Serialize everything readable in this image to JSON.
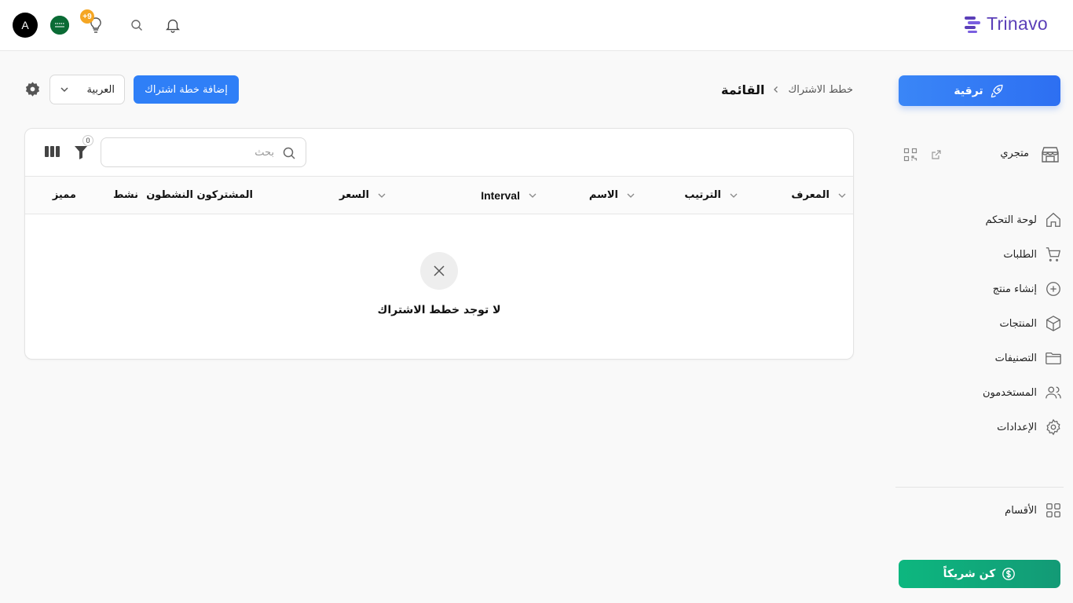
{
  "header": {
    "brand": "Trinavo",
    "avatar_letter": "A",
    "notification_badge": "+9"
  },
  "sidebar": {
    "upgrade_label": "ترقية",
    "store_label": "متجري",
    "items": [
      {
        "label": "لوحة التحكم",
        "icon": "home-icon"
      },
      {
        "label": "الطلبات",
        "icon": "cart-icon"
      },
      {
        "label": "إنشاء منتج",
        "icon": "plus-circle-icon"
      },
      {
        "label": "المنتجات",
        "icon": "box-icon"
      },
      {
        "label": "التصنيفات",
        "icon": "folder-icon"
      },
      {
        "label": "المستخدمون",
        "icon": "users-icon"
      },
      {
        "label": "الإعدادات",
        "icon": "gear-icon"
      }
    ],
    "sections_label": "الأقسام",
    "partner_label": "كن شريكاً"
  },
  "page": {
    "breadcrumb_parent": "خطط الاشتراك",
    "breadcrumb_current": "القائمة",
    "add_button": "إضافة خطة اشتراك",
    "language": "العربية"
  },
  "table": {
    "search_placeholder": "بحث",
    "filter_count": "0",
    "columns": [
      "المعرف",
      "الترتيب",
      "الاسم",
      "Interval",
      "السعر",
      "المشتركون النشطون",
      "نشط",
      "مميز"
    ],
    "empty_message": "لا توجد خطط الاشتراك"
  },
  "colors": {
    "brand": "#5b3fb8",
    "primary": "#2f7ff7",
    "partner": "#0db77f",
    "badge": "#f5a623"
  }
}
